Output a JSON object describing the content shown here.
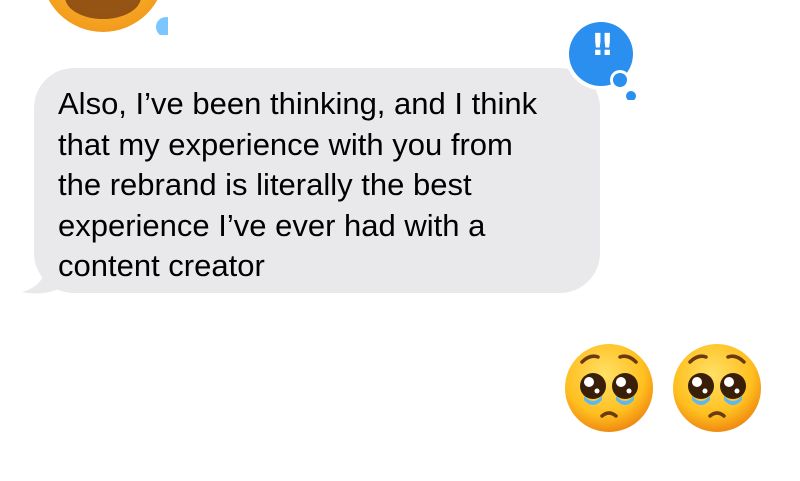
{
  "thread": {
    "previous_message": {
      "icon": "emoji-icon",
      "partially_visible": true
    },
    "received_message": {
      "text": "Also, I’ve been thinking, and I think\nthat my experience with you from\nthe rebrand is literally the best\nexperience I’ve ever had with a\ncontent creator",
      "bubble_color": "#e9e9eb",
      "text_color": "#000000",
      "reaction": {
        "label": "‼",
        "type": "emphasize",
        "color": "#2b8ff0"
      }
    },
    "sent_message": {
      "emojis": [
        "🥺",
        "🥺"
      ],
      "icon": "pleading-face-emoji-icon"
    }
  }
}
